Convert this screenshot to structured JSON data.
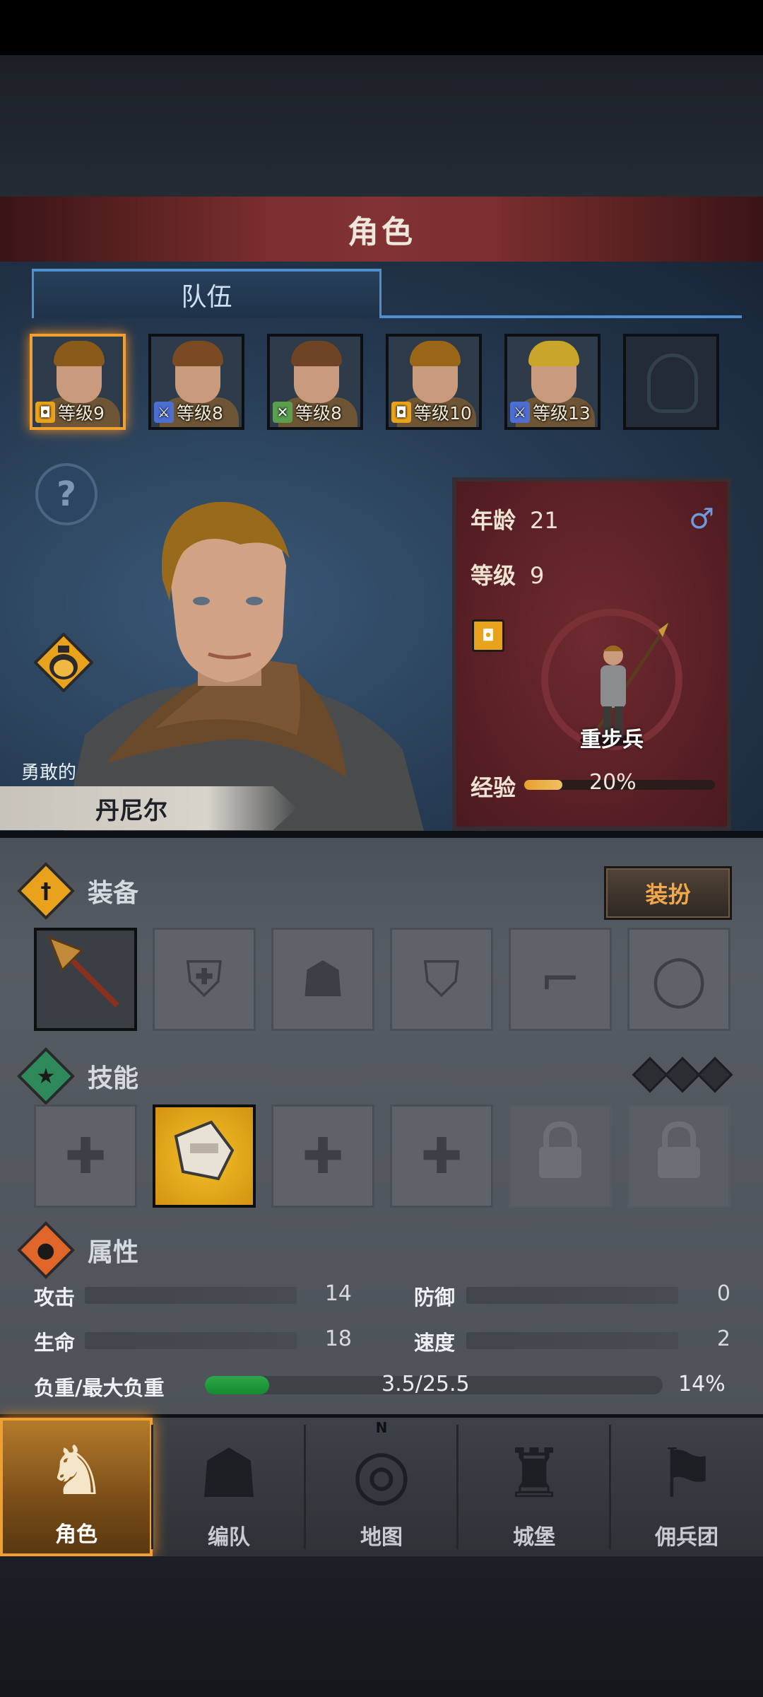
{
  "screen_title": "角色",
  "tabs": [
    {
      "label": "队伍"
    }
  ],
  "party": [
    {
      "role": "shield",
      "role_icon": "shield-icon",
      "level_label": "等级9",
      "hair": "#8a5a1a",
      "selected": true
    },
    {
      "role": "sword",
      "role_icon": "sword-icon",
      "level_label": "等级8",
      "hair": "#7a4a22",
      "selected": false
    },
    {
      "role": "bow",
      "role_icon": "bow-icon",
      "level_label": "等级8",
      "hair": "#6e4424",
      "selected": false
    },
    {
      "role": "shield",
      "role_icon": "shield-icon",
      "level_label": "等级10",
      "hair": "#9a6618",
      "selected": false
    },
    {
      "role": "sword",
      "role_icon": "sword-icon",
      "level_label": "等级13",
      "hair": "#c9a52a",
      "selected": false
    },
    {
      "role": "empty",
      "role_icon": "helmet-placeholder-icon",
      "level_label": "",
      "selected": false
    }
  ],
  "character": {
    "title": "勇敢的",
    "name": "丹尼尔",
    "age_label": "年龄",
    "age": "21",
    "level_label": "等级",
    "level": "9",
    "gender": "♂",
    "unit_class": "重步兵",
    "exp_label": "经验",
    "exp_percent": "20%",
    "exp_fraction": 0.2
  },
  "equipment": {
    "title": "装备",
    "dress_button": "装扮",
    "slots": [
      {
        "name": "spear-slot",
        "icon": "spear-icon",
        "filled": true
      },
      {
        "name": "shield-slot",
        "icon": "shield-icon",
        "filled": false
      },
      {
        "name": "helmet-slot",
        "icon": "helmet-icon",
        "filled": false
      },
      {
        "name": "armor-slot",
        "icon": "armor-icon",
        "filled": false
      },
      {
        "name": "boots-slot",
        "icon": "boots-icon",
        "filled": false
      },
      {
        "name": "ring-slot",
        "icon": "ring-icon",
        "filled": false
      }
    ]
  },
  "skills": {
    "title": "技能",
    "points_icons": 3,
    "slots": [
      {
        "state": "empty",
        "icon": "cross-icon"
      },
      {
        "state": "learned",
        "icon": "armored-fist-icon"
      },
      {
        "state": "empty",
        "icon": "cross-icon"
      },
      {
        "state": "empty",
        "icon": "cross-icon"
      },
      {
        "state": "locked",
        "icon": "lock-icon"
      },
      {
        "state": "locked",
        "icon": "lock-icon"
      }
    ]
  },
  "attributes": {
    "title": "属性",
    "attack_label": "攻击",
    "attack": "14",
    "defense_label": "防御",
    "defense": "0",
    "hp_label": "生命",
    "hp": "18",
    "speed_label": "速度",
    "speed": "2",
    "load_label": "负重/最大负重",
    "load": "3.5/25.5",
    "load_percent": "14%",
    "load_fraction": 0.14
  },
  "nav": [
    {
      "label": "角色",
      "icon": "knight-icon",
      "active": true
    },
    {
      "label": "编队",
      "icon": "helmet-icon",
      "active": false
    },
    {
      "label": "地图",
      "icon": "compass-map-icon",
      "active": false,
      "compass_letter": "N"
    },
    {
      "label": "城堡",
      "icon": "castle-icon",
      "active": false
    },
    {
      "label": "佣兵团",
      "icon": "mercenary-flag-icon",
      "active": false
    }
  ],
  "colors": {
    "accent_gold": "#f0a030",
    "banner_red": "#6e2a30",
    "tab_blue": "#4f8fd0",
    "load_green": "#2ea84a"
  }
}
